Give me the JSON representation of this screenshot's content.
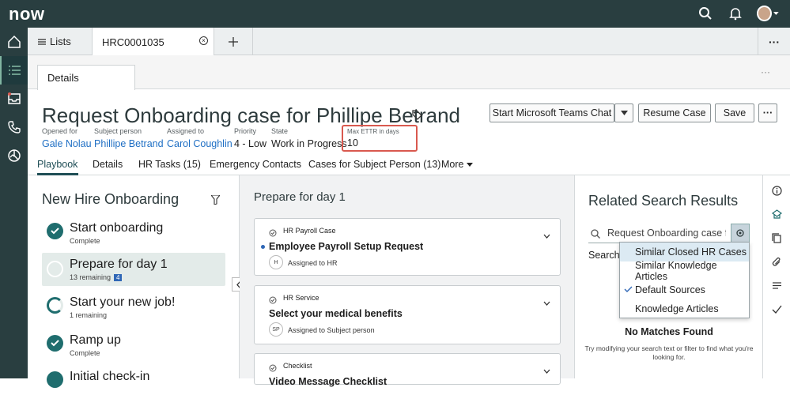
{
  "app": {
    "logo": "now"
  },
  "tabs": {
    "lists_label": "Lists",
    "record_label": "HRC0001035"
  },
  "subtab": {
    "details_label": "Details"
  },
  "record": {
    "title": "Request Onboarding case for Phillipe Betrand",
    "fields": [
      {
        "label": "Opened for",
        "value": "Gale Nolau"
      },
      {
        "label": "Subject person",
        "value": "Phillipe Betrand"
      },
      {
        "label": "Assigned to",
        "value": "Carol Coughlin"
      },
      {
        "label": "Priority",
        "value": "4 - Low"
      },
      {
        "label": "State",
        "value": "Work in Progress"
      },
      {
        "label": "Max ETTR in days",
        "value": "10"
      }
    ]
  },
  "actions": {
    "teams_label": "Start Microsoft Teams Chat",
    "resume_label": "Resume Case",
    "save_label": "Save"
  },
  "nav_tabs": [
    "Playbook",
    "Details",
    "HR Tasks (15)",
    "Emergency Contacts",
    "Cases for Subject Person (13)",
    "More"
  ],
  "playbook": {
    "title": "New Hire Onboarding",
    "steps": [
      {
        "name": "Start onboarding",
        "sub": "Complete"
      },
      {
        "name": "Prepare for day 1",
        "sub": "13 remaining",
        "badge": "4"
      },
      {
        "name": "Start your new job!",
        "sub": "1 remaining"
      },
      {
        "name": "Ramp up",
        "sub": "Complete"
      },
      {
        "name": "Initial check-in",
        "sub": ""
      }
    ]
  },
  "stage": {
    "title": "Prepare for day 1",
    "cards": [
      {
        "type": "HR Payroll Case",
        "title": "Employee Payroll Setup Request",
        "avatar": "H",
        "assigned": "Assigned to HR"
      },
      {
        "type": "HR Service",
        "title": "Select your medical benefits",
        "avatar": "SP",
        "assigned": "Assigned to Subject person"
      },
      {
        "type": "Checklist",
        "title": "Video Message Checklist"
      }
    ]
  },
  "related": {
    "title": "Related Search Results",
    "search_value": "Request Onboarding case for",
    "search_label": "Search a",
    "dropdown": [
      "Similar Closed HR Cases",
      "Similar Knowledge Articles",
      "Default Sources",
      "Knowledge Articles"
    ],
    "no_matches": "No Matches Found",
    "hint": "Try modifying your search text or filter to find what you're looking for."
  },
  "colors": {
    "brand_dark": "#293e40",
    "accent_green": "#81b5a1",
    "link": "#1f6fc4",
    "highlight_border": "#d9594f"
  }
}
